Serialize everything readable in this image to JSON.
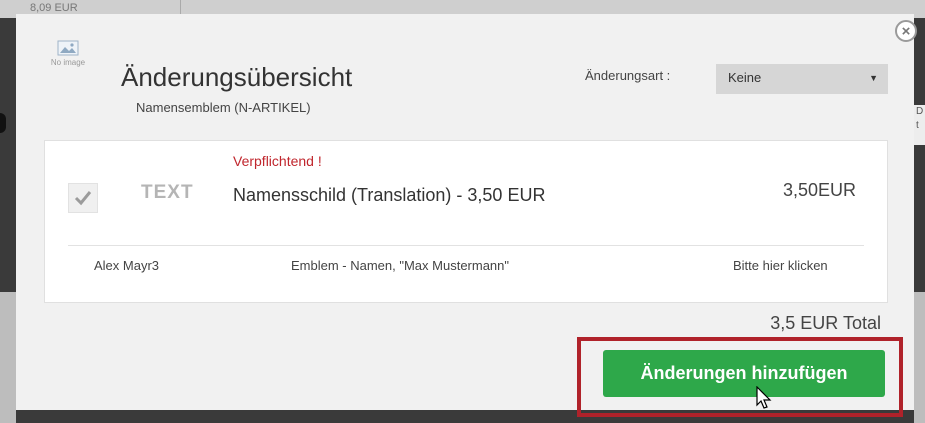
{
  "background": {
    "top_text": "8,09 EUR",
    "right_text": "D t"
  },
  "modal": {
    "no_image_label": "No image",
    "title": "Änderungsübersicht",
    "subtitle": "Namensemblem (N-ARTIKEL)",
    "change_type_label": "Änderungsart :",
    "change_type_value": "Keine",
    "item": {
      "mandatory_text": "Verpflichtend !",
      "type_icon_text": "TEXT",
      "name": "Namensschild (Translation) - 3,50 EUR",
      "price": "3,50EUR",
      "checked": true,
      "person": "Alex Mayr3",
      "emblem_text": "Emblem - Namen, \"Max Mustermann\"",
      "action_link": "Bitte hier klicken"
    },
    "total": "3,5 EUR Total",
    "add_button_label": "Änderungen hinzufügen"
  },
  "colors": {
    "accent_green": "#2ea84a",
    "mandatory_red": "#c0262d",
    "highlight_red": "#b0222a"
  }
}
